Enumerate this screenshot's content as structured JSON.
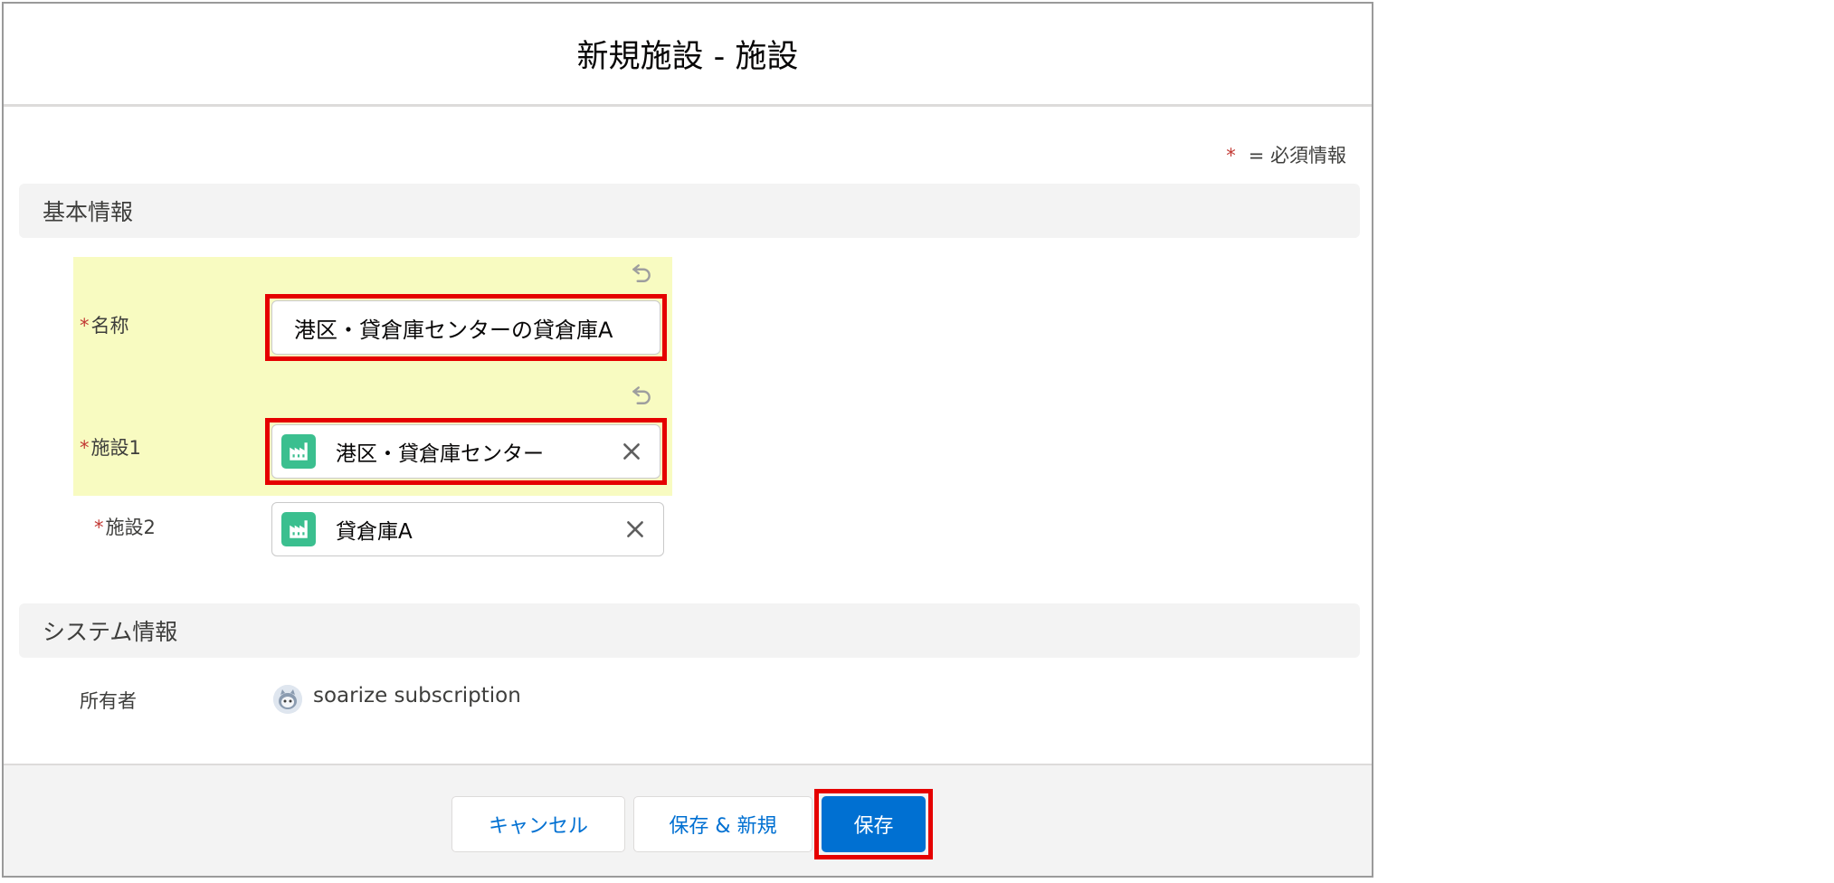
{
  "modal": {
    "title": "新規施設 - 施設",
    "required_legend": {
      "star": "*",
      "text": "= 必須情報"
    }
  },
  "sections": {
    "basic": {
      "title": "基本情報"
    },
    "system": {
      "title": "システム情報"
    }
  },
  "fields": {
    "name": {
      "required": "*",
      "label": "名称",
      "value": "港区・貸倉庫センターの貸倉庫A"
    },
    "facility1": {
      "required": "*",
      "label": "施設1",
      "value": "港区・貸倉庫センター"
    },
    "facility2": {
      "required": "*",
      "label": "施設2",
      "value": "貸倉庫A"
    },
    "owner": {
      "label": "所有者",
      "value": "soarize subscription"
    }
  },
  "footer": {
    "cancel_label": "キャンセル",
    "save_new_label": "保存 & 新規",
    "save_label": "保存"
  },
  "colors": {
    "brand": "#0070d2",
    "required": "#c23934",
    "highlight": "#f8fbc1",
    "lookup_icon": "#3bbf8f",
    "annotation_outline": "#e50000"
  },
  "icons": {
    "undo": "undo-icon",
    "facility": "factory-icon",
    "clear": "close-icon",
    "avatar": "user-avatar-icon"
  }
}
